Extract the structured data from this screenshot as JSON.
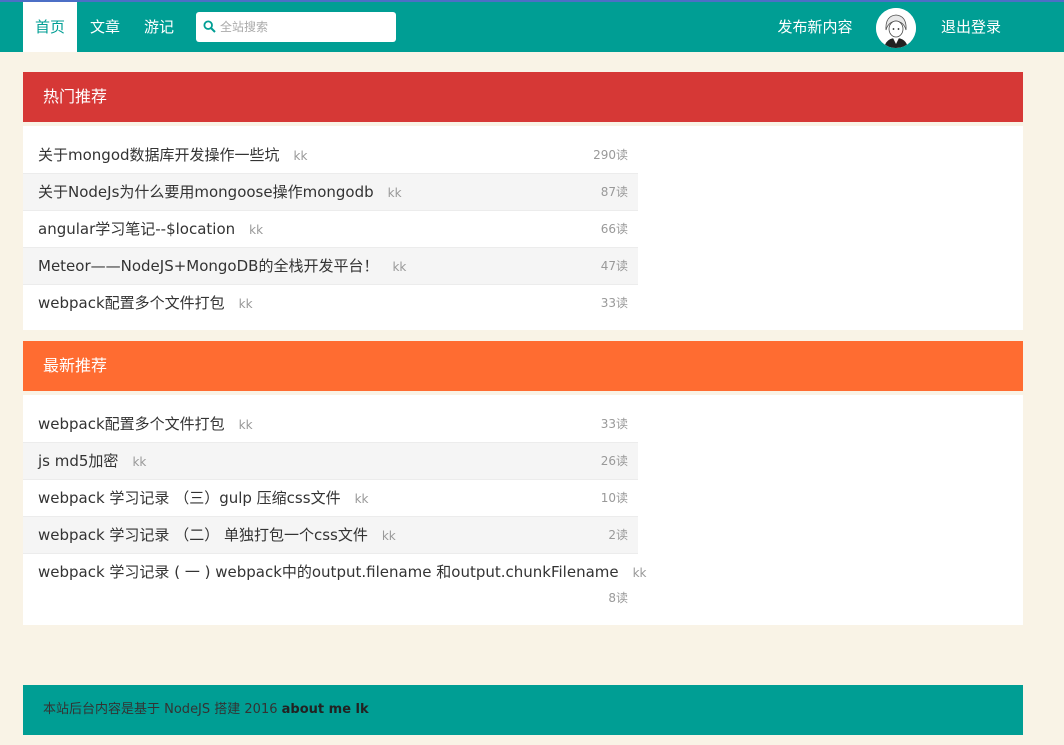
{
  "nav": {
    "home": "首页",
    "articles": "文章",
    "guest": "游记",
    "publish": "发布新内容",
    "logout": "退出登录"
  },
  "search": {
    "placeholder": "全站搜索",
    "value": ""
  },
  "hot": {
    "title": "热门推荐",
    "items": [
      {
        "title": "关于mongod数据库开发操作一些坑",
        "author": "kk",
        "reads": "290读"
      },
      {
        "title": "关于NodeJs为什么要用mongoose操作mongodb",
        "author": "kk",
        "reads": "87读"
      },
      {
        "title": "angular学习笔记--$location",
        "author": "kk",
        "reads": "66读"
      },
      {
        "title": "Meteor——NodeJS+MongoDB的全栈开发平台！",
        "author": "kk",
        "reads": "47读"
      },
      {
        "title": "webpack配置多个文件打包",
        "author": "kk",
        "reads": "33读"
      }
    ]
  },
  "latest": {
    "title": "最新推荐",
    "items": [
      {
        "title": "webpack配置多个文件打包",
        "author": "kk",
        "reads": "33读"
      },
      {
        "title": "js md5加密",
        "author": "kk",
        "reads": "26读"
      },
      {
        "title": "webpack 学习记录 （三）gulp 压缩css文件",
        "author": "kk",
        "reads": "10读"
      },
      {
        "title": "webpack 学习记录 （二） 单独打包一个css文件",
        "author": "kk",
        "reads": "2读"
      },
      {
        "title": "webpack 学习记录 ( 一 ) webpack中的output.filename 和output.chunkFilename",
        "author": "kk",
        "reads": "8读"
      }
    ]
  },
  "footer": {
    "text": "本站后台内容是基于 NodeJS 搭建 2016 ",
    "link": "about me lk"
  },
  "colors": {
    "topbar": "#009e94",
    "hot": "#d63836",
    "latest": "#ff6c31",
    "page_bg": "#f9f3e6"
  },
  "icons": [
    "search-icon",
    "avatar"
  ]
}
